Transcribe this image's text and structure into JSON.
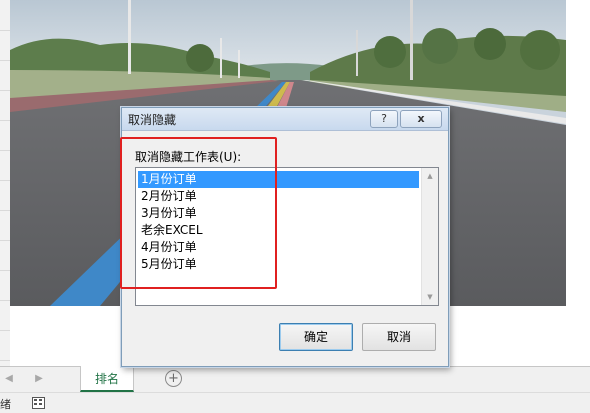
{
  "dialog": {
    "title": "取消隐藏",
    "help_label": "?",
    "close_label": "x",
    "list_label": "取消隐藏工作表(U):",
    "sheets": [
      "1月份订单",
      "2月份订单",
      "3月份订单",
      "老余EXCEL",
      "4月份订单",
      "5月份订单"
    ],
    "selected_sheet": "1月份订单",
    "ok_label": "确定",
    "cancel_label": "取消"
  },
  "tabbar": {
    "active_sheet": "排名",
    "add_label": "+"
  },
  "statusbar": {
    "text": "绪"
  },
  "colors": {
    "accent_green": "#217346",
    "selection_blue": "#3399ff",
    "annotation_red": "#e02020"
  }
}
